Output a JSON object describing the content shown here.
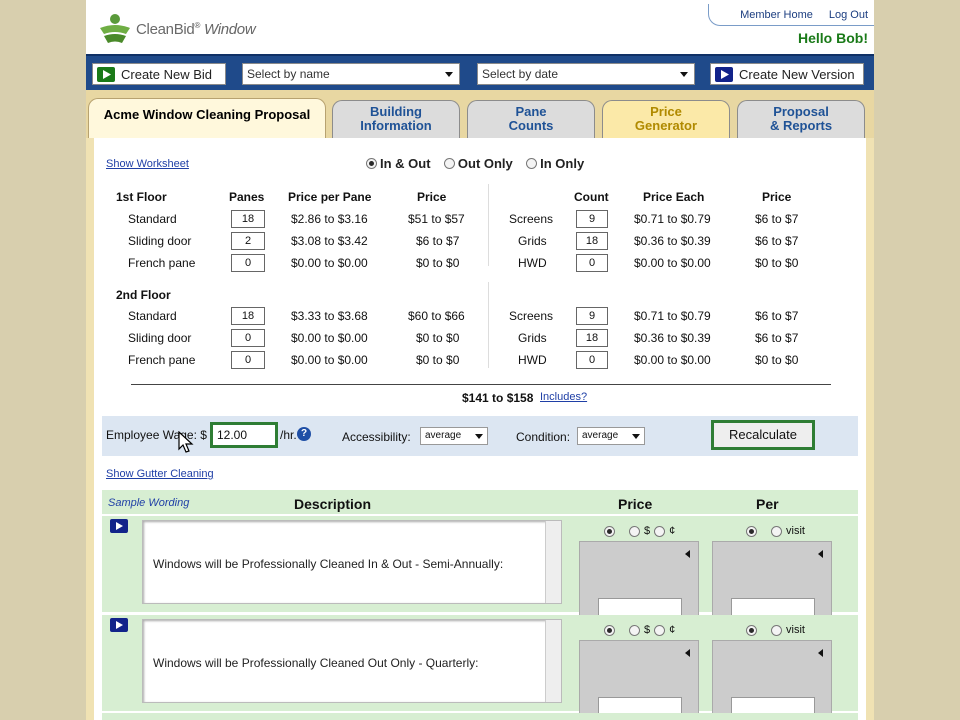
{
  "header": {
    "logo_brand": "CleanBid",
    "logo_reg": "®",
    "logo_window": "Window",
    "member_home": "Member Home",
    "log_out": "Log Out",
    "hello": "Hello Bob!"
  },
  "toolbar": {
    "create_bid": "Create New Bid",
    "select_name": "Select by name",
    "select_date": "Select by date",
    "create_version": "Create New Version"
  },
  "tabs": [
    {
      "label": "Acme Window Cleaning Proposal"
    },
    {
      "label": "Building\nInformation"
    },
    {
      "label": "Pane\nCounts"
    },
    {
      "label": "Price\nGenerator"
    },
    {
      "label": "Proposal\n& Reports"
    }
  ],
  "worksheet": {
    "show_worksheet": "Show Worksheet",
    "modes": [
      "In & Out",
      "Out Only",
      "In Only"
    ],
    "selected_mode": "In & Out",
    "pane_headers": [
      "Panes",
      "Price per Pane",
      "Price"
    ],
    "screen_headers": [
      "Count",
      "Price Each",
      "Price"
    ],
    "floors": [
      {
        "name": "1st Floor",
        "rows": [
          {
            "type": "Standard",
            "panes": "18",
            "ppp": "$2.86 to $3.16",
            "price": "$51 to $57",
            "extra": "Screens",
            "count": "9",
            "each": "$0.71 to $0.79",
            "eprice": "$6 to $7"
          },
          {
            "type": "Sliding door",
            "panes": "2",
            "ppp": "$3.08 to $3.42",
            "price": "$6 to $7",
            "extra": "Grids",
            "count": "18",
            "each": "$0.36 to $0.39",
            "eprice": "$6 to $7"
          },
          {
            "type": "French pane",
            "panes": "0",
            "ppp": "$0.00 to $0.00",
            "price": "$0 to $0",
            "extra": "HWD",
            "count": "0",
            "each": "$0.00 to $0.00",
            "eprice": "$0 to $0"
          }
        ]
      },
      {
        "name": "2nd Floor",
        "rows": [
          {
            "type": "Standard",
            "panes": "18",
            "ppp": "$3.33 to $3.68",
            "price": "$60 to $66",
            "extra": "Screens",
            "count": "9",
            "each": "$0.71 to $0.79",
            "eprice": "$6 to $7"
          },
          {
            "type": "Sliding door",
            "panes": "0",
            "ppp": "$0.00 to $0.00",
            "price": "$0 to $0",
            "extra": "Grids",
            "count": "18",
            "each": "$0.36 to $0.39",
            "eprice": "$6 to $7"
          },
          {
            "type": "French pane",
            "panes": "0",
            "ppp": "$0.00 to $0.00",
            "price": "$0 to $0",
            "extra": "HWD",
            "count": "0",
            "each": "$0.00 to $0.00",
            "eprice": "$0 to $0"
          }
        ]
      }
    ],
    "total": "$141 to $158",
    "includes": "Includes?"
  },
  "wage": {
    "label": "Employee Wage: $",
    "value": "12.00",
    "unit": "/hr.",
    "accessibility_label": "Accessibility:",
    "accessibility_value": "average",
    "condition_label": "Condition:",
    "condition_value": "average",
    "recalculate": "Recalculate"
  },
  "gutter": {
    "show": "Show Gutter Cleaning"
  },
  "wording": {
    "sample": "Sample Wording",
    "description": "Description",
    "price": "Price",
    "per": "Per",
    "price_opts": [
      "$",
      "¢"
    ],
    "per_opts": [
      "visit"
    ],
    "items": [
      {
        "text": "Windows will be Professionally Cleaned In & Out - Semi-Annually:"
      },
      {
        "text": "Windows will be Professionally Cleaned Out Only - Quarterly:"
      }
    ]
  }
}
